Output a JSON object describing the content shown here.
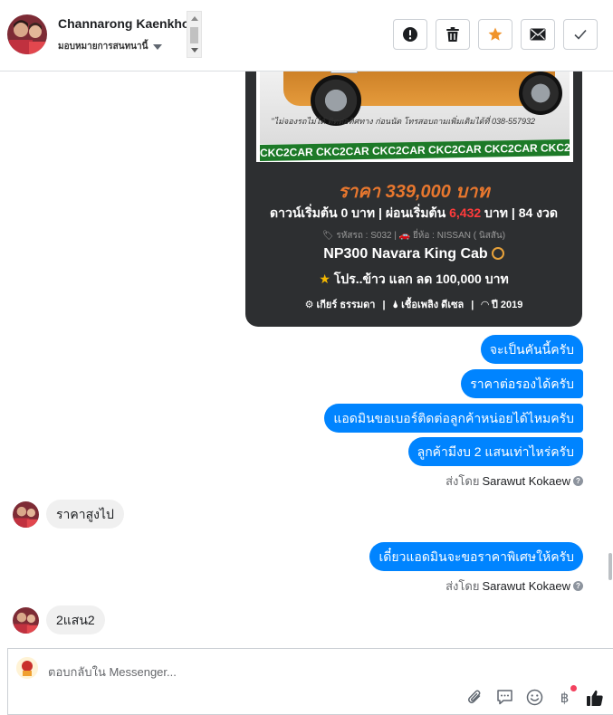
{
  "header": {
    "contact_name": "Channarong Kaenkhot",
    "assign_label": "มอบหมายการสนทนานี้",
    "actions": [
      {
        "icon": "alert-icon",
        "label": "Mark as spam"
      },
      {
        "icon": "trash-icon",
        "label": "Delete"
      },
      {
        "icon": "star-icon",
        "label": "Star"
      },
      {
        "icon": "envelope-icon",
        "label": "Mark as unread"
      },
      {
        "icon": "check-icon",
        "label": "Mark as done"
      }
    ],
    "colors": {
      "star": "#f0932b"
    }
  },
  "product_card": {
    "watermark": "CKC2CAR CKC2CAR CKC2CAR CKC2CAR CKC2CAR CKC2CAR",
    "phone_note": "\"ไม่จองรถไม่ได้ ติดต่อทิศทาง ก่อนนัด โทรสอบถามเพิ่มเติมได้ที่ 038-557932",
    "price": "ราคา 339,000 บาท",
    "down_prefix": "ดาวน์เริ่มต้น 0 บาท | ผ่อนเริ่มต้น ",
    "installment": "6,432",
    "down_suffix": " บาท | 84 งวด",
    "meta": "🏷 รหัสรถ : S032 | 🚗 ยี่ห้อ : NISSAN ( นิสสัน)",
    "model": "NP300 Navara King Cab",
    "promo": "โปร..ข้าว แลก ลด 100,000 บาท",
    "spec_gear": "⚙ เกียร์ ธรรมดา",
    "spec_fuel": "🌢 เชื้อเพลิง ดีเซล",
    "spec_year": "◠ ปี 2019",
    "colors": {
      "background": "#2d2f31",
      "price": "#e8772e",
      "installment": "#ff3b3b"
    }
  },
  "messages": {
    "out_group_1": [
      "จะเป็นคันนี้ครับ",
      "ราคาต่อรองได้ครับ",
      "แอดมินขอเบอร์ติดต่อลูกค้าหน่อยได้ไหมครับ",
      "ลูกค้ามีงบ 2 แสนเท่าไหร่ครับ"
    ],
    "sent_by_prefix": "ส่งโดย",
    "sent_by_name_1": "Sarawut Kokaew",
    "in_1": "ราคาสูงไป",
    "out_2": "เดี๋ยวแอดมินจะขอราคาพิเศษให้ครับ",
    "sent_by_name_2": "Sarawut Kokaew",
    "in_2": "2แสน2",
    "colors": {
      "outgoing": "#0084ff",
      "incoming": "#f0f0f0"
    }
  },
  "composer": {
    "placeholder": "ตอบกลับใน Messenger...",
    "tools": [
      "attach-icon",
      "saved-reply-icon",
      "emoji-icon",
      "baht-payment-icon",
      "like-icon"
    ]
  }
}
